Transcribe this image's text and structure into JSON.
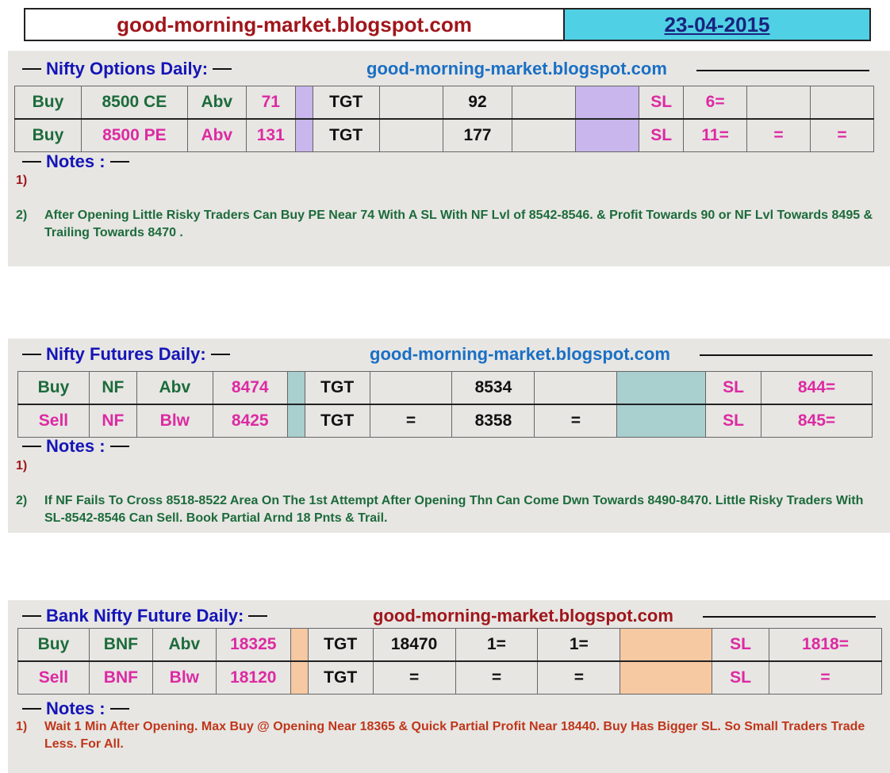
{
  "header": {
    "site": "good-morning-market.blogspot.com",
    "date": "23-04-2015"
  },
  "options": {
    "title": "Nifty  Options  Daily:",
    "site": "good-morning-market.blogspot.com",
    "rows": [
      [
        "Buy",
        "8500 CE",
        "Abv",
        "71",
        "",
        "TGT",
        "",
        "92",
        "",
        "",
        "SL",
        "6=",
        "",
        ""
      ],
      [
        "Buy",
        "8500 PE",
        "Abv",
        "131",
        "",
        "TGT",
        "",
        "177",
        "",
        "",
        "SL",
        "11=",
        "=",
        "="
      ]
    ],
    "notes_label": "Notes :",
    "note1_num": "1)",
    "note2_num": "2)",
    "note2_text": "After Opening Little Risky Traders Can Buy PE Near 74 With A SL With NF Lvl of 8542-8546.  & Profit Towards 90 or NF Lvl Towards 8495  & Trailing Towards 8470 ."
  },
  "futures": {
    "title": "Nifty Futures  Daily:",
    "site": "good-morning-market.blogspot.com",
    "rows": [
      [
        "Buy",
        "NF",
        "Abv",
        "8474",
        "",
        "TGT",
        "",
        "8534",
        "",
        "",
        "SL",
        "844="
      ],
      [
        "Sell",
        "NF",
        "Blw",
        "8425",
        "",
        "TGT",
        "=",
        "8358",
        "=",
        "",
        "SL",
        "845="
      ]
    ],
    "notes_label": "Notes :",
    "note1_num": "1)",
    "note2_num": "2)",
    "note2_text": "If NF Fails To Cross 8518-8522 Area On The 1st Attempt After Opening Thn Can Come Dwn Towards 8490-8470. Little Risky Traders With SL-8542-8546 Can Sell. Book Partial Arnd 18 Pnts & Trail."
  },
  "bank": {
    "title": "Bank Nifty Future  Daily:",
    "site": "good-morning-market.blogspot.com",
    "rows": [
      [
        "Buy",
        "BNF",
        "Abv",
        "18325",
        "",
        "TGT",
        "18470",
        "1=",
        "1=",
        "",
        "SL",
        "1818="
      ],
      [
        "Sell",
        "BNF",
        "Blw",
        "18120",
        "",
        "TGT",
        "=",
        "=",
        "=",
        "",
        "SL",
        "="
      ]
    ],
    "notes_label": "Notes :",
    "note1_num": "1)",
    "note1_text": "Wait 1 Min After Opening.  Max Buy @ Opening Near 18365 & Quick Partial Profit Near 18440.  Buy Has Bigger SL. So Small Traders Trade Less.  For All."
  },
  "colors": {
    "site_red": "#a0161b",
    "date_bg": "#4fd0e4",
    "title_blue": "#1515b8",
    "site_blue": "#1a6fc4",
    "green": "#1d6b3b",
    "pink": "#dd2aa2",
    "lavender": "#c8b6ec",
    "teal": "#a9cfcf",
    "peach": "#f6c9a2",
    "panel": "#e7e6e3"
  }
}
